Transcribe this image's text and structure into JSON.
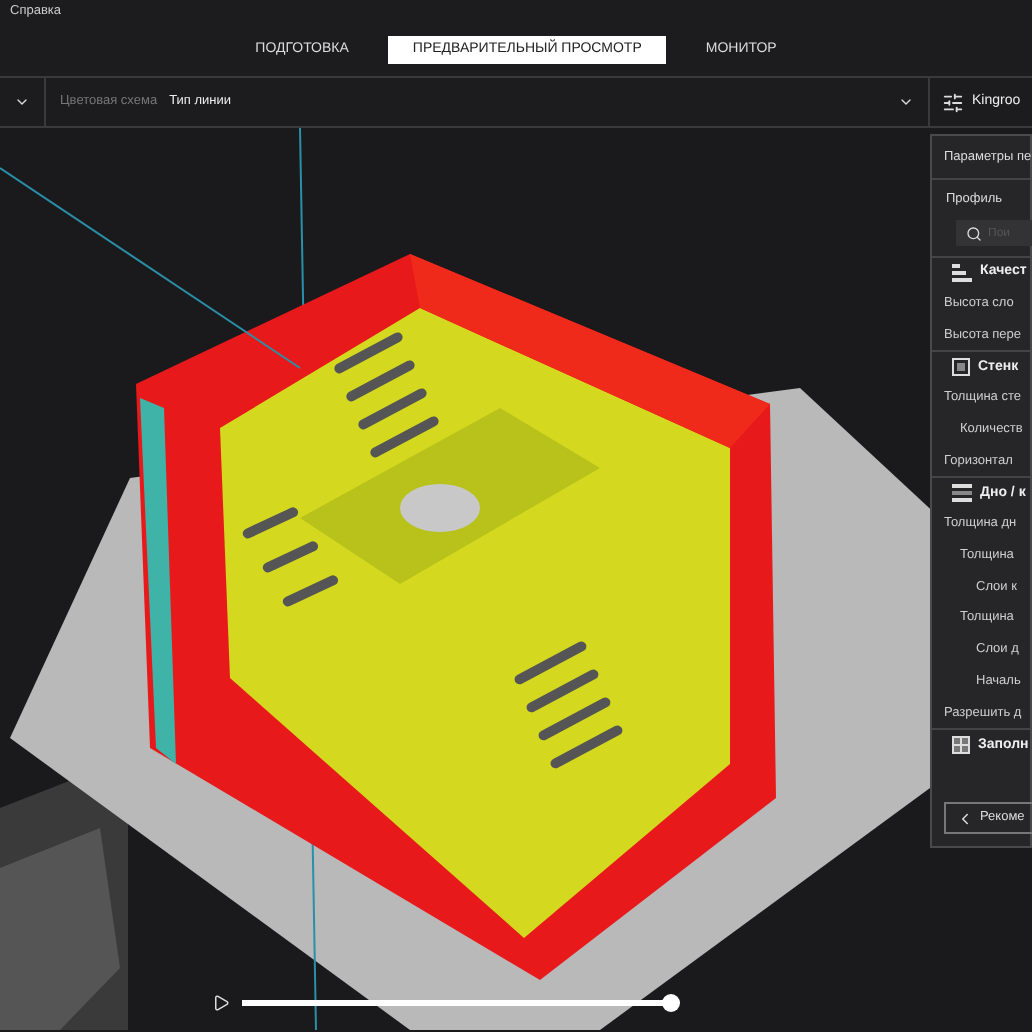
{
  "menu": {
    "item": "Справка"
  },
  "stages": [
    {
      "label": "ПОДГОТОВКА",
      "selected": false
    },
    {
      "label": "ПРЕДВАРИТЕЛЬНЫЙ ПРОСМОТР",
      "selected": true
    },
    {
      "label": "МОНИТОР",
      "selected": false
    }
  ],
  "toolbar": {
    "color_scheme_label": "Цветовая схема",
    "color_scheme_value": "Тип линии",
    "printer": "Kingroo"
  },
  "print_settings": {
    "title": "Параметры пе",
    "profile_label": "Профиль",
    "search": {
      "placeholder": "Пои"
    },
    "categories": [
      {
        "name": "Качест",
        "kind": "quality",
        "settings": [
          {
            "label": "Высота сло"
          },
          {
            "label": "Высота пере"
          }
        ]
      },
      {
        "name": "Стенк",
        "kind": "walls",
        "settings": [
          {
            "label": "Толщина сте",
            "children": [
              {
                "label": "Количеств"
              }
            ]
          },
          {
            "label": "Горизонтал"
          }
        ]
      },
      {
        "name": "Дно / к",
        "kind": "bottom",
        "settings": [
          {
            "label": "Толщина дн",
            "children": [
              {
                "label": "Толщина",
                "children": [
                  {
                    "label": "Слои к"
                  }
                ]
              },
              {
                "label": "Толщина",
                "children": [
                  {
                    "label": "Слои д"
                  },
                  {
                    "label": "Началь"
                  }
                ]
              }
            ]
          },
          {
            "label": "Разрешить д"
          }
        ]
      },
      {
        "name": "Заполн",
        "kind": "infill"
      }
    ],
    "recommended_button": "Рекоме"
  },
  "playback": {
    "level": 1.0
  }
}
